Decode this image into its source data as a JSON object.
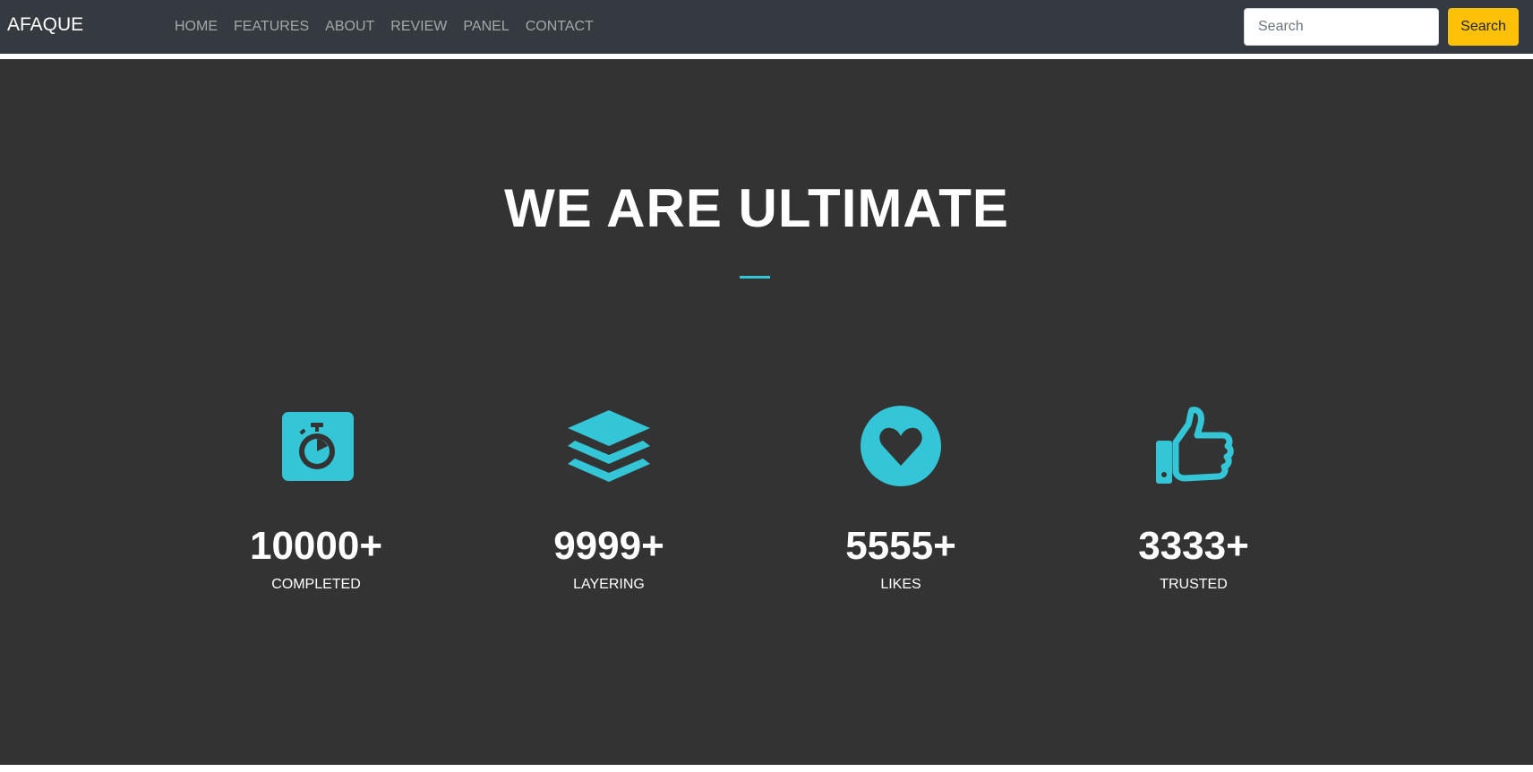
{
  "navbar": {
    "brand": "AFAQUE",
    "links": [
      {
        "label": "HOME"
      },
      {
        "label": "FEATURES"
      },
      {
        "label": "ABOUT"
      },
      {
        "label": "REVIEW"
      },
      {
        "label": "PANEL"
      },
      {
        "label": "CONTACT"
      }
    ],
    "search": {
      "placeholder": "Search",
      "button_label": "Search"
    }
  },
  "stats_section": {
    "title": "WE ARE ULTIMATE",
    "items": [
      {
        "number": "10000+",
        "label": "COMPLETED",
        "icon": "stopwatch-icon"
      },
      {
        "number": "9999+",
        "label": "LAYERING",
        "icon": "layers-icon"
      },
      {
        "number": "5555+",
        "label": "LIKES",
        "icon": "heart-icon"
      },
      {
        "number": "3333+",
        "label": "TRUSTED",
        "icon": "thumbs-up-icon"
      }
    ]
  },
  "colors": {
    "navbar_bg": "#343a40",
    "section_bg": "#333333",
    "accent": "#34c6d6",
    "search_button": "#ffc107"
  }
}
